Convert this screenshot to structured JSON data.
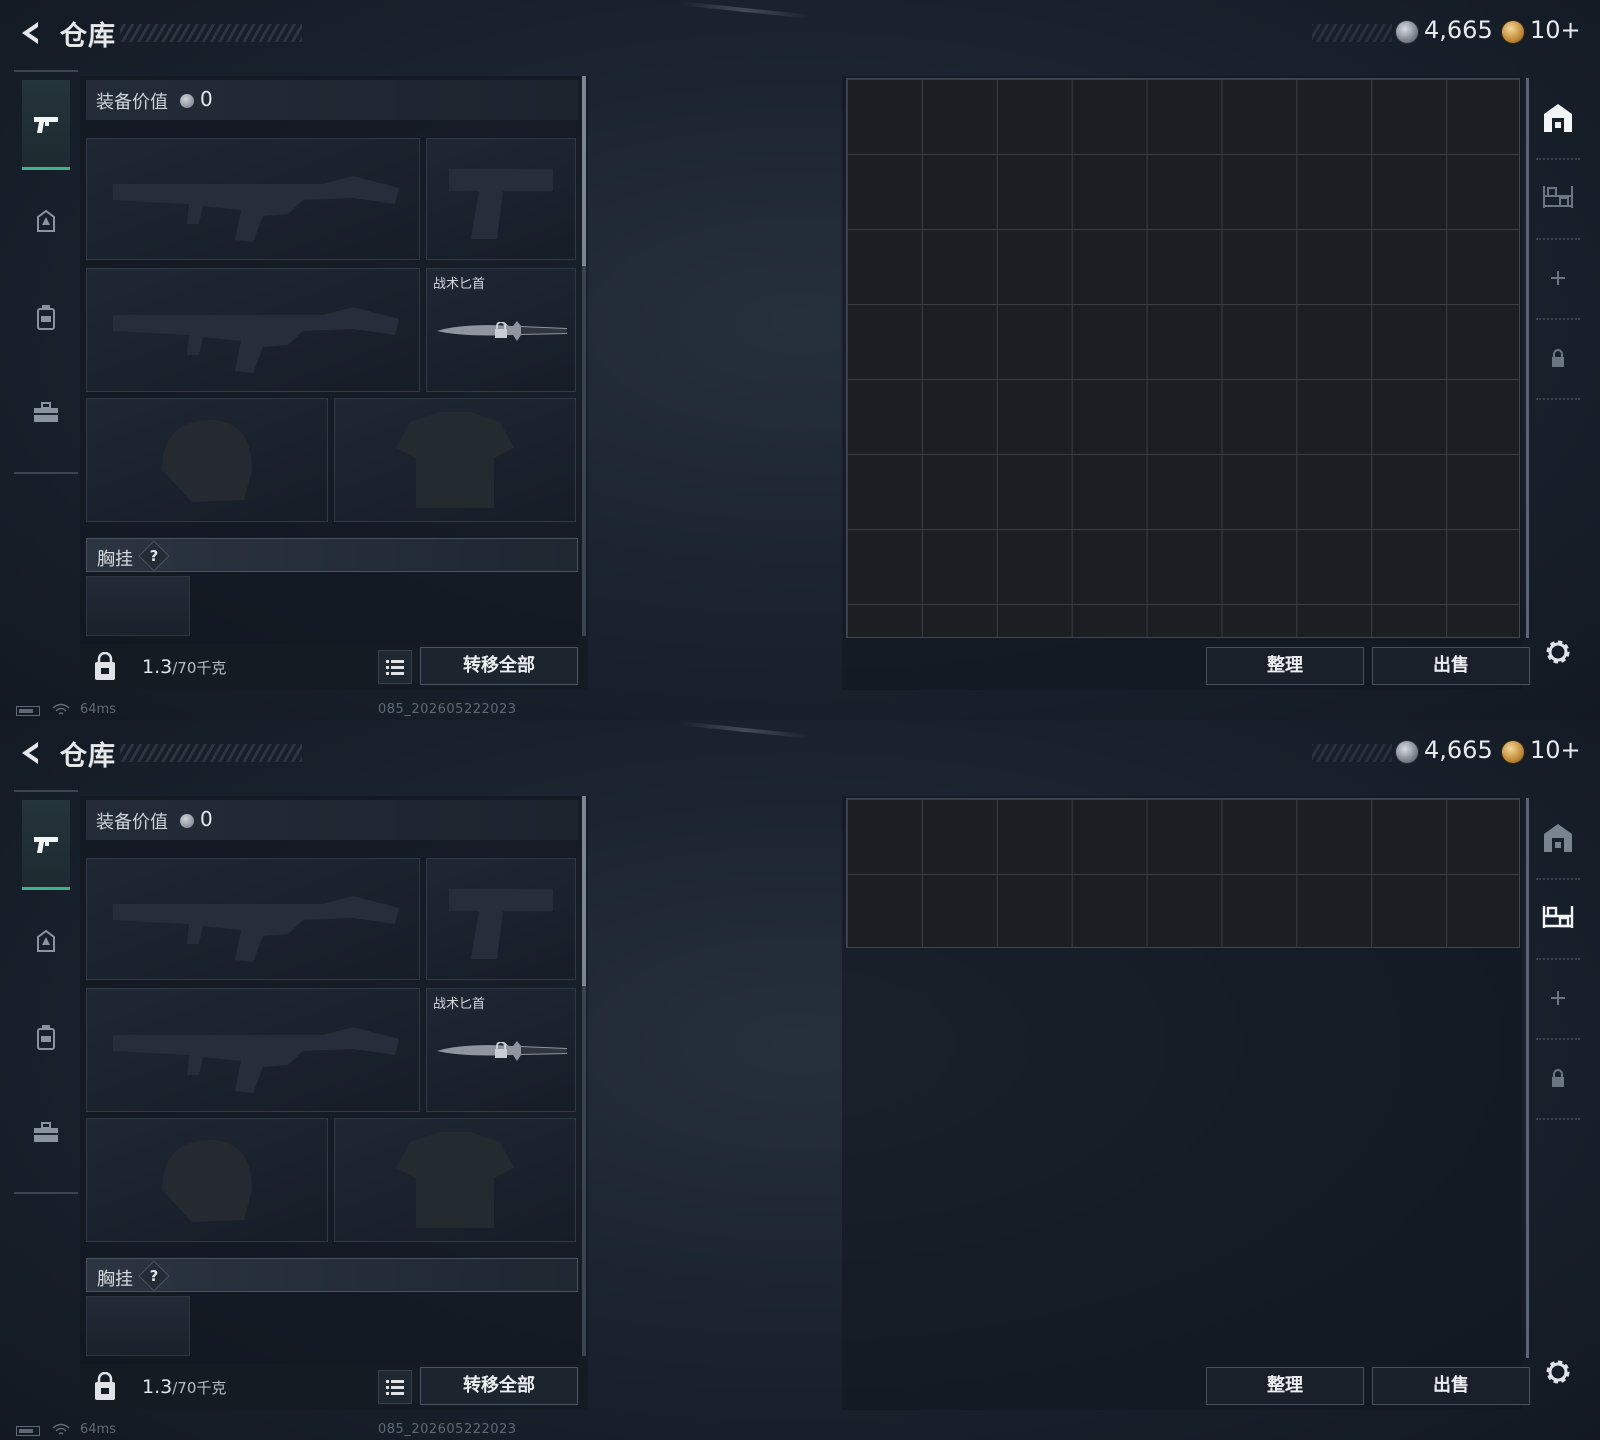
{
  "panels": [
    {
      "header": {
        "title": "仓库",
        "currency_1": "4,665",
        "currency_2": "10+"
      },
      "equipment": {
        "value_label": "装备价值",
        "value": "0",
        "knife_label": "战术匕首",
        "vest_label": "胸挂",
        "help": "?",
        "weight": "1.3",
        "weight_unit": "/70千克",
        "transfer_all": "转移全部"
      },
      "storage": {
        "sort": "整理",
        "sell": "出售",
        "active_tab": "storage"
      },
      "status": {
        "ping": "64ms",
        "build": "085_202605222023"
      }
    },
    {
      "header": {
        "title": "仓库",
        "currency_1": "4,665",
        "currency_2": "10+"
      },
      "equipment": {
        "value_label": "装备价值",
        "value": "0",
        "knife_label": "战术匕首",
        "vest_label": "胸挂",
        "help": "?",
        "weight": "1.3",
        "weight_unit": "/70千克",
        "transfer_all": "转移全部"
      },
      "storage": {
        "sort": "整理",
        "sell": "出售",
        "active_tab": "shelf"
      },
      "status": {
        "ping": "64ms",
        "build": "085_202605222023"
      }
    }
  ],
  "icons": {
    "rail": [
      "pistol-icon",
      "helmet-icon",
      "backpack-icon",
      "toolbox-icon"
    ],
    "right_rail": [
      "storage-icon",
      "shelf-icon",
      "add-icon",
      "lock-icon"
    ],
    "settings": "gear-icon"
  },
  "colors": {
    "accent": "#3fb58a",
    "background": "#1b2430",
    "grid": "#1b1e22"
  }
}
